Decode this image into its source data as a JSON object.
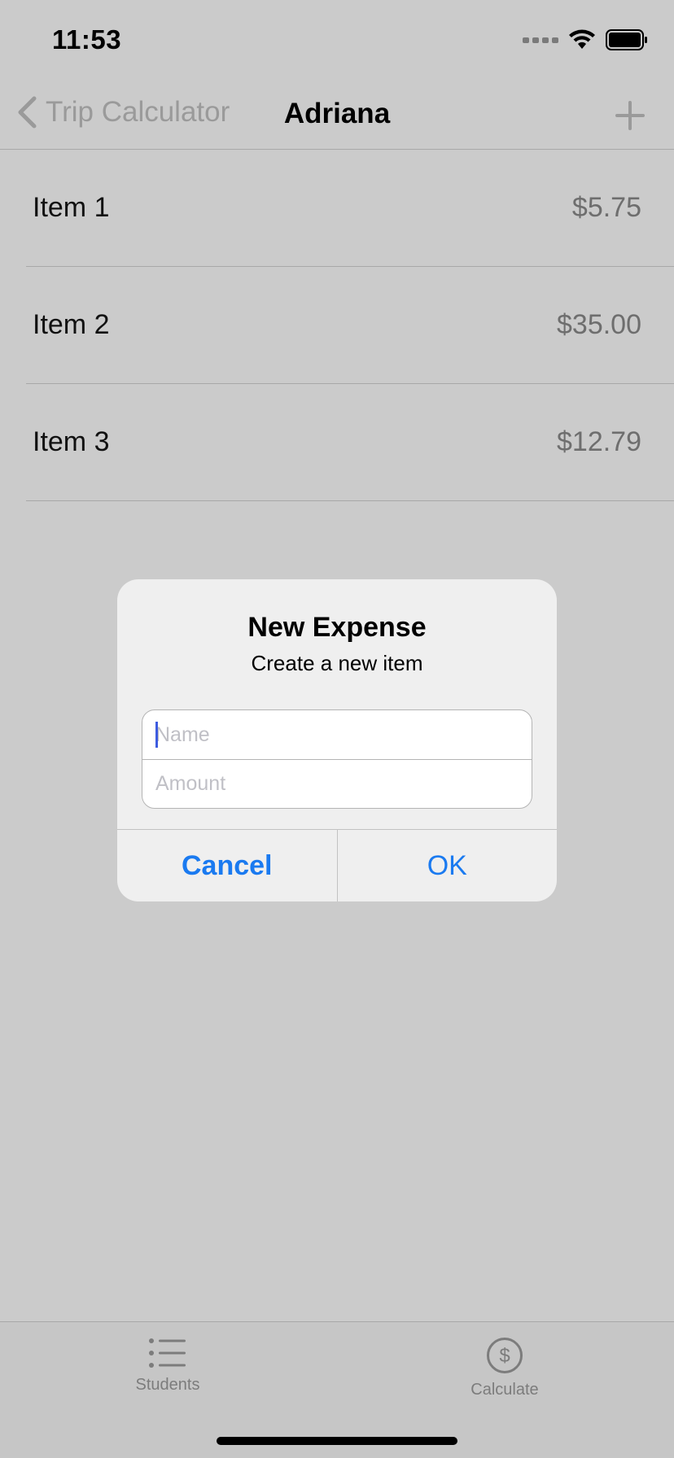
{
  "status_bar": {
    "time": "11:53"
  },
  "nav": {
    "back_label": "Trip Calculator",
    "title": "Adriana"
  },
  "items": [
    {
      "name": "Item 1",
      "amount": "$5.75"
    },
    {
      "name": "Item 2",
      "amount": "$35.00"
    },
    {
      "name": "Item 3",
      "amount": "$12.79"
    }
  ],
  "alert": {
    "title": "New Expense",
    "message": "Create a new item",
    "name_placeholder": "Name",
    "amount_placeholder": "Amount",
    "cancel_label": "Cancel",
    "ok_label": "OK"
  },
  "tabs": [
    {
      "label": "Students",
      "icon": "list-icon"
    },
    {
      "label": "Calculate",
      "icon": "dollar-circle-icon"
    }
  ],
  "colors": {
    "accent": "#1a7af0",
    "cursor": "#3d5be0"
  }
}
